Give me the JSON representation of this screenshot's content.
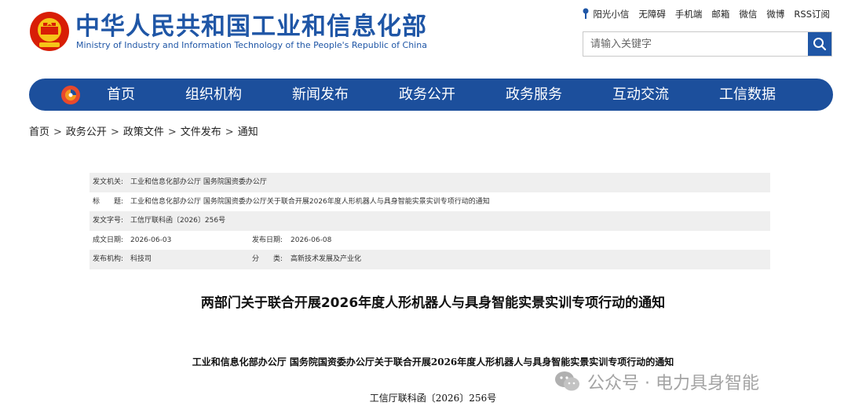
{
  "header": {
    "site_title": "中华人民共和国工业和信息化部",
    "site_subtitle": "Ministry of Industry and Information Technology of the People's Republic of China",
    "emblem_icon": "national-emblem-icon",
    "top_links": [
      "阳光小信",
      "无障碍",
      "手机端",
      "邮箱",
      "微信",
      "微博",
      "RSS订阅"
    ],
    "search": {
      "placeholder": "请输入关键字",
      "icon": "search-icon"
    },
    "brand_color": "#1f56a6"
  },
  "nav": {
    "logo_icon": "miit-logo-icon",
    "items": [
      "首页",
      "组织机构",
      "新闻发布",
      "政务公开",
      "政务服务",
      "互动交流",
      "工信数据"
    ],
    "background_color": "#1c4f9c"
  },
  "breadcrumb": [
    "首页",
    "政务公开",
    "政策文件",
    "文件发布",
    "通知"
  ],
  "info": {
    "issuer_label": "发文机关:",
    "issuer_value": "工业和信息化部办公厅 国务院国资委办公厅",
    "title_label": "标　　题:",
    "title_value": "工业和信息化部办公厅 国务院国资委办公厅关于联合开展2026年度人形机器人与具身智能实景实训专项行动的通知",
    "docno_label": "发文字号:",
    "docno_value": "工信厅联科函〔2026〕256号",
    "created_label": "成文日期:",
    "created_value": "2026-06-03",
    "published_label": "发布日期:",
    "published_value": "2026-06-08",
    "org_label": "发布机构:",
    "org_value": "科技司",
    "category_label": "分　　类:",
    "category_value": "高新技术发展及产业化"
  },
  "document": {
    "title": "两部门关于联合开展2026年度人形机器人与具身智能实景实训专项行动的通知",
    "heading": "工业和信息化部办公厅 国务院国资委办公厅关于联合开展2026年度人形机器人与具身智能实景实训专项行动的通知",
    "number": "工信厅联科函〔2026〕256号"
  },
  "watermark": {
    "text": "公众号 · 电力具身智能",
    "icon": "wechat-icon"
  }
}
